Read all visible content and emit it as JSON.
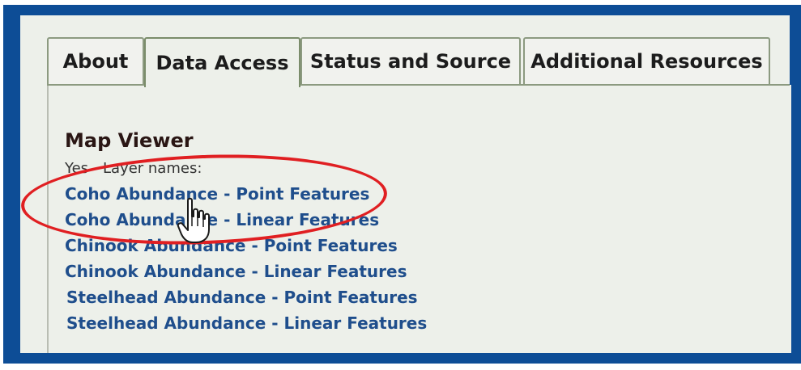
{
  "tabs": [
    {
      "label": "About",
      "active": false
    },
    {
      "label": "Data Access",
      "active": true
    },
    {
      "label": "Status and Source",
      "active": false
    },
    {
      "label": "Additional Resources",
      "active": false
    }
  ],
  "section": {
    "heading": "Map Viewer",
    "subtext": "Yes - Layer names:"
  },
  "layers": [
    "Coho Abundance - Point Features",
    "Coho Abundance - Linear Features",
    "Chinook Abundance - Point Features",
    "Chinook Abundance - Linear Features",
    "Steelhead Abundance - Point Features",
    "Steelhead Abundance - Linear Features"
  ],
  "colors": {
    "border": "#0d4d96",
    "panel": "#edf0ea",
    "link": "#1f4e8c",
    "annotation": "#e01f22"
  },
  "icons": {
    "cursor": "hand-pointer-icon"
  }
}
